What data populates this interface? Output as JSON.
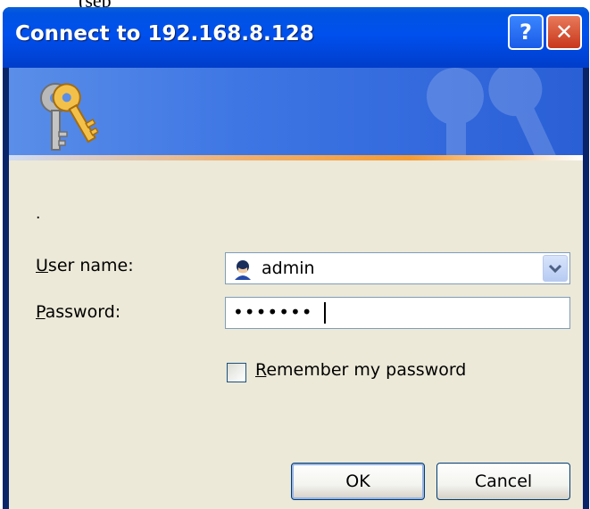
{
  "page_fragment": {
    "text": "(sep"
  },
  "dialog": {
    "title": "Connect to 192.168.8.128",
    "help_button": "?",
    "close_button": "✕",
    "message": ".",
    "username": {
      "label_accel": "U",
      "label_rest": "ser name:",
      "value": "admin"
    },
    "password": {
      "label_accel": "P",
      "label_rest": "assword:",
      "masked_value": "•••••••"
    },
    "remember": {
      "label_accel": "R",
      "label_rest": "emember my password",
      "checked": false
    },
    "ok_button": "OK",
    "cancel_button": "Cancel"
  },
  "icons": [
    "keys-icon",
    "user-icon",
    "chevron-down-icon",
    "help-icon",
    "close-icon"
  ]
}
